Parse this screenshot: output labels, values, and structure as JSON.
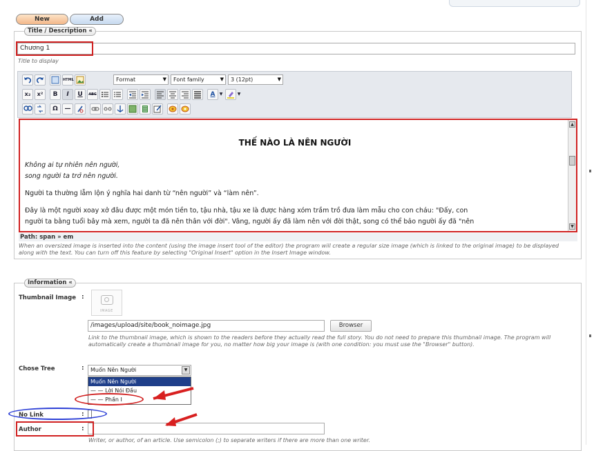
{
  "buttons": {
    "new_label": "New",
    "add_label": "Add"
  },
  "title_section": {
    "legend": "Title / Description «",
    "title_value": "Chương 1",
    "title_hint": "Title to display"
  },
  "toolbar": {
    "format_label": "Format",
    "font_family_label": "Font family",
    "font_size_label": "3 (12pt)",
    "btn_subscript": "x₂",
    "btn_superscript": "x²",
    "btn_bold": "B",
    "btn_italic": "I",
    "btn_underline": "U",
    "btn_strike": "ABC",
    "btn_html": "HTML",
    "btn_omega": "Ω",
    "btn_hr": "—",
    "btn_fontcolor": "A"
  },
  "editor": {
    "heading": "THẾ NÀO LÀ NÊN NGƯỜI",
    "line1": "Không ai tự nhiên nên người,",
    "line2": "song người ta trở nên người.",
    "para2": "Người ta thường lẫm lộn ý nghĩa hai danh từ “nên người” và “làm nên”.",
    "para3a": "Đây là một người xoay xở đâu được một món tiền to, tậu nhà, tậu xe là được hàng xóm trầm trồ đưa làm mẫu cho con cháu: \"Đấy, con",
    "para3b": "người ta bằng tuổi bây mà xem, người ta đã nên thân với đời\". Vâng, người ấy đã làm nên với đời thật, song có thể bảo người ấy đã \"nên",
    "path_text": "Path: span » em"
  },
  "editor_note": "When an oversized image is inserted into the content (using the image insert tool of the editor) the program will create a regular size image (which is linked to the original image) to be displayed along with the text. You can turn off this feature by selecting \"Original Insert\" option in the Insert Image window.",
  "information": {
    "legend": "Information «",
    "thumbnail_label": "Thumbnail Image",
    "thumbnail_placeholder": "IMAGE",
    "thumbnail_path": "/images/upload/site/book_noimage.jpg",
    "browser_button": "Browser",
    "thumbnail_hint": "Link to the thumbnail image, which is shown to the readers before they actually read the full story. You do not need to prepare this thumbnail image. The program will automatically create a thumbnail image for you, no matter how big your image is (with one condition: you must use the \"Browser\" button).",
    "tree_label": "Chose Tree",
    "tree_selected": "Muốn Nên Người",
    "tree_options": [
      "Muốn Nên Người",
      "— — Lời Nói Đầu",
      "— — Phần I"
    ],
    "nolink_label": "No Link",
    "author_label": "Author",
    "author_value": "",
    "author_hint": "Writer, or author, of an article. Use semicolon (;) to separate writers if there are more than one writer."
  },
  "colors": {
    "annotation_red": "#d02020",
    "annotation_blue": "#2c3fd6",
    "selected_option": "#1f3f8a"
  }
}
